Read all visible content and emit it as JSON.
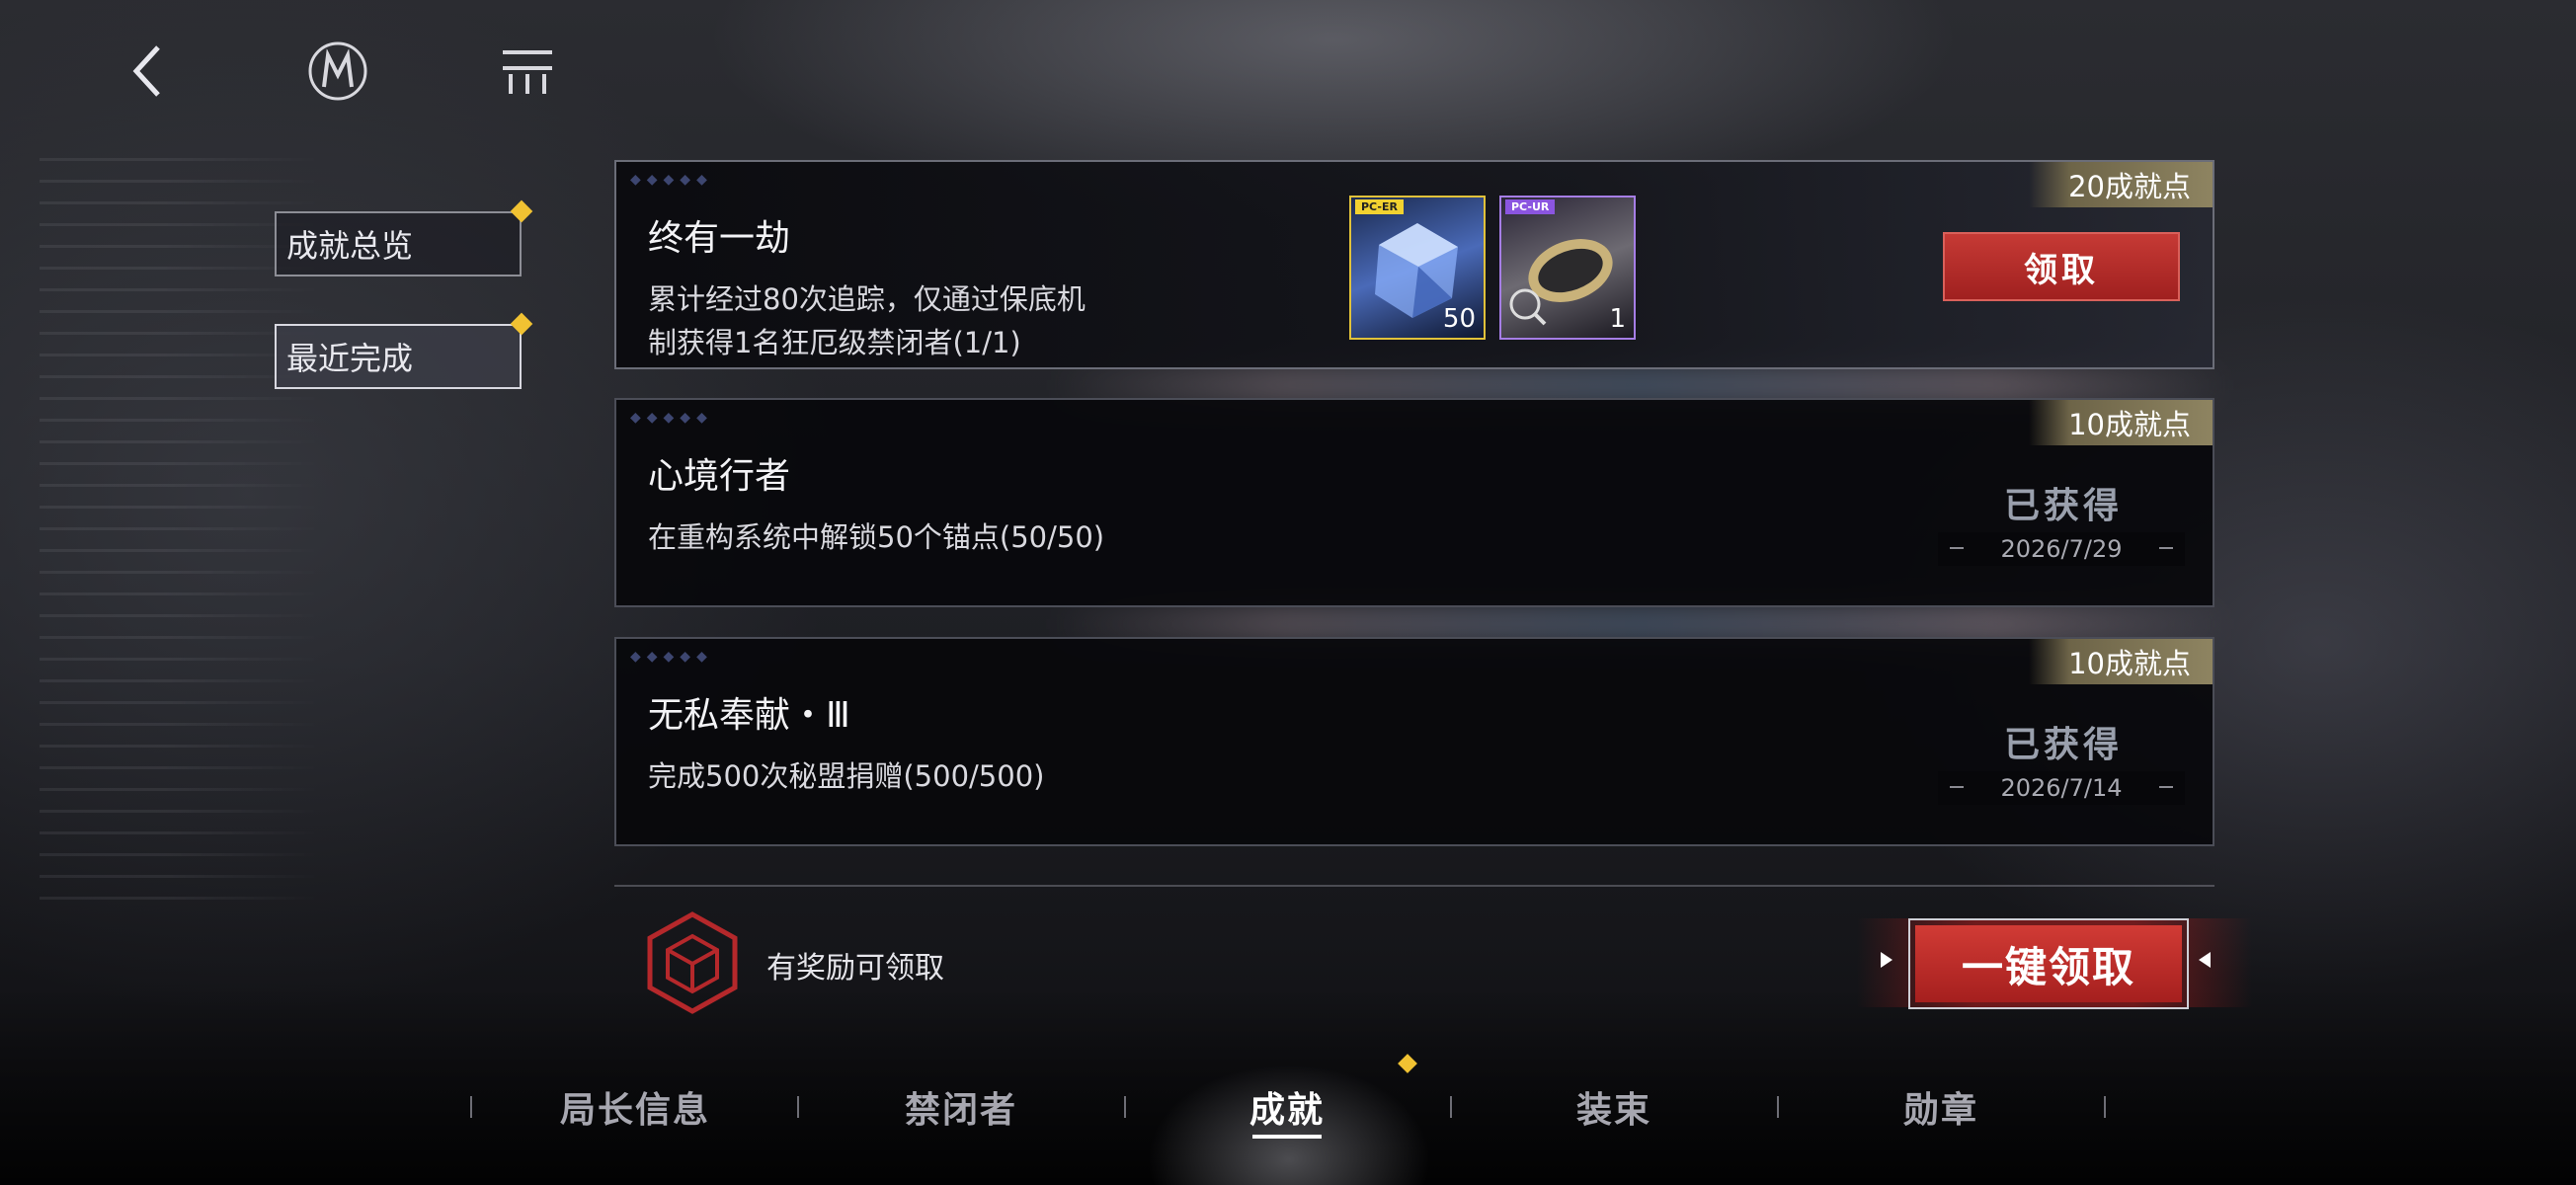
{
  "side_tabs": [
    {
      "label": "成就总览"
    },
    {
      "label": "最近完成"
    }
  ],
  "achievements": [
    {
      "title": "终有一劫",
      "desc_line1": "累计经过80次追踪，仅通过保底机",
      "desc_line2": "制获得1名狂厄级禁闭者(1/1)",
      "points": "20成就点",
      "action_label": "领取",
      "rewards": [
        {
          "tag": "PC-ER",
          "icon": "crystal-cube-icon",
          "count": "50"
        },
        {
          "tag": "PC-UR",
          "icon": "classified-tag-icon",
          "count": "1"
        }
      ]
    },
    {
      "title": "心境行者",
      "desc": "在重构系统中解锁50个锚点(50/50)",
      "points": "10成就点",
      "status": "已获得",
      "date": "2026/7/29"
    },
    {
      "title": "无私奉献・Ⅲ",
      "desc": "完成500次秘盟捐赠(500/500)",
      "points": "10成就点",
      "status": "已获得",
      "date": "2026/7/14"
    }
  ],
  "footer": {
    "reward_text": "有奖励可领取",
    "claim_all_label": "一键领取"
  },
  "nav": [
    {
      "label": "局长信息"
    },
    {
      "label": "禁闭者"
    },
    {
      "label": "成就"
    },
    {
      "label": "装束"
    },
    {
      "label": "勋章"
    }
  ],
  "colors": {
    "accent_red": "#c63a35",
    "gold_dot": "#f1c232",
    "points_gold": "#8e8461"
  }
}
